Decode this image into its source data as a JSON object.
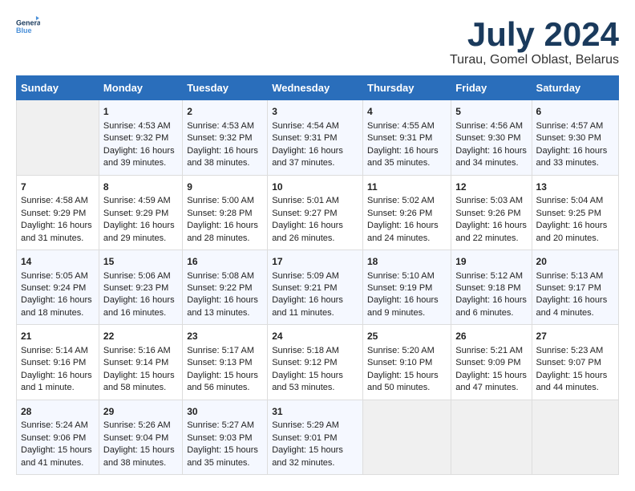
{
  "logo": {
    "line1": "General",
    "line2": "Blue"
  },
  "title": "July 2024",
  "subtitle": "Turau, Gomel Oblast, Belarus",
  "headers": [
    "Sunday",
    "Monday",
    "Tuesday",
    "Wednesday",
    "Thursday",
    "Friday",
    "Saturday"
  ],
  "weeks": [
    [
      {
        "day": "",
        "data": ""
      },
      {
        "day": "1",
        "data": "Sunrise: 4:53 AM\nSunset: 9:32 PM\nDaylight: 16 hours and 39 minutes."
      },
      {
        "day": "2",
        "data": "Sunrise: 4:53 AM\nSunset: 9:32 PM\nDaylight: 16 hours and 38 minutes."
      },
      {
        "day": "3",
        "data": "Sunrise: 4:54 AM\nSunset: 9:31 PM\nDaylight: 16 hours and 37 minutes."
      },
      {
        "day": "4",
        "data": "Sunrise: 4:55 AM\nSunset: 9:31 PM\nDaylight: 16 hours and 35 minutes."
      },
      {
        "day": "5",
        "data": "Sunrise: 4:56 AM\nSunset: 9:30 PM\nDaylight: 16 hours and 34 minutes."
      },
      {
        "day": "6",
        "data": "Sunrise: 4:57 AM\nSunset: 9:30 PM\nDaylight: 16 hours and 33 minutes."
      }
    ],
    [
      {
        "day": "7",
        "data": "Sunrise: 4:58 AM\nSunset: 9:29 PM\nDaylight: 16 hours and 31 minutes."
      },
      {
        "day": "8",
        "data": "Sunrise: 4:59 AM\nSunset: 9:29 PM\nDaylight: 16 hours and 29 minutes."
      },
      {
        "day": "9",
        "data": "Sunrise: 5:00 AM\nSunset: 9:28 PM\nDaylight: 16 hours and 28 minutes."
      },
      {
        "day": "10",
        "data": "Sunrise: 5:01 AM\nSunset: 9:27 PM\nDaylight: 16 hours and 26 minutes."
      },
      {
        "day": "11",
        "data": "Sunrise: 5:02 AM\nSunset: 9:26 PM\nDaylight: 16 hours and 24 minutes."
      },
      {
        "day": "12",
        "data": "Sunrise: 5:03 AM\nSunset: 9:26 PM\nDaylight: 16 hours and 22 minutes."
      },
      {
        "day": "13",
        "data": "Sunrise: 5:04 AM\nSunset: 9:25 PM\nDaylight: 16 hours and 20 minutes."
      }
    ],
    [
      {
        "day": "14",
        "data": "Sunrise: 5:05 AM\nSunset: 9:24 PM\nDaylight: 16 hours and 18 minutes."
      },
      {
        "day": "15",
        "data": "Sunrise: 5:06 AM\nSunset: 9:23 PM\nDaylight: 16 hours and 16 minutes."
      },
      {
        "day": "16",
        "data": "Sunrise: 5:08 AM\nSunset: 9:22 PM\nDaylight: 16 hours and 13 minutes."
      },
      {
        "day": "17",
        "data": "Sunrise: 5:09 AM\nSunset: 9:21 PM\nDaylight: 16 hours and 11 minutes."
      },
      {
        "day": "18",
        "data": "Sunrise: 5:10 AM\nSunset: 9:19 PM\nDaylight: 16 hours and 9 minutes."
      },
      {
        "day": "19",
        "data": "Sunrise: 5:12 AM\nSunset: 9:18 PM\nDaylight: 16 hours and 6 minutes."
      },
      {
        "day": "20",
        "data": "Sunrise: 5:13 AM\nSunset: 9:17 PM\nDaylight: 16 hours and 4 minutes."
      }
    ],
    [
      {
        "day": "21",
        "data": "Sunrise: 5:14 AM\nSunset: 9:16 PM\nDaylight: 16 hours and 1 minute."
      },
      {
        "day": "22",
        "data": "Sunrise: 5:16 AM\nSunset: 9:14 PM\nDaylight: 15 hours and 58 minutes."
      },
      {
        "day": "23",
        "data": "Sunrise: 5:17 AM\nSunset: 9:13 PM\nDaylight: 15 hours and 56 minutes."
      },
      {
        "day": "24",
        "data": "Sunrise: 5:18 AM\nSunset: 9:12 PM\nDaylight: 15 hours and 53 minutes."
      },
      {
        "day": "25",
        "data": "Sunrise: 5:20 AM\nSunset: 9:10 PM\nDaylight: 15 hours and 50 minutes."
      },
      {
        "day": "26",
        "data": "Sunrise: 5:21 AM\nSunset: 9:09 PM\nDaylight: 15 hours and 47 minutes."
      },
      {
        "day": "27",
        "data": "Sunrise: 5:23 AM\nSunset: 9:07 PM\nDaylight: 15 hours and 44 minutes."
      }
    ],
    [
      {
        "day": "28",
        "data": "Sunrise: 5:24 AM\nSunset: 9:06 PM\nDaylight: 15 hours and 41 minutes."
      },
      {
        "day": "29",
        "data": "Sunrise: 5:26 AM\nSunset: 9:04 PM\nDaylight: 15 hours and 38 minutes."
      },
      {
        "day": "30",
        "data": "Sunrise: 5:27 AM\nSunset: 9:03 PM\nDaylight: 15 hours and 35 minutes."
      },
      {
        "day": "31",
        "data": "Sunrise: 5:29 AM\nSunset: 9:01 PM\nDaylight: 15 hours and 32 minutes."
      },
      {
        "day": "",
        "data": ""
      },
      {
        "day": "",
        "data": ""
      },
      {
        "day": "",
        "data": ""
      }
    ]
  ]
}
